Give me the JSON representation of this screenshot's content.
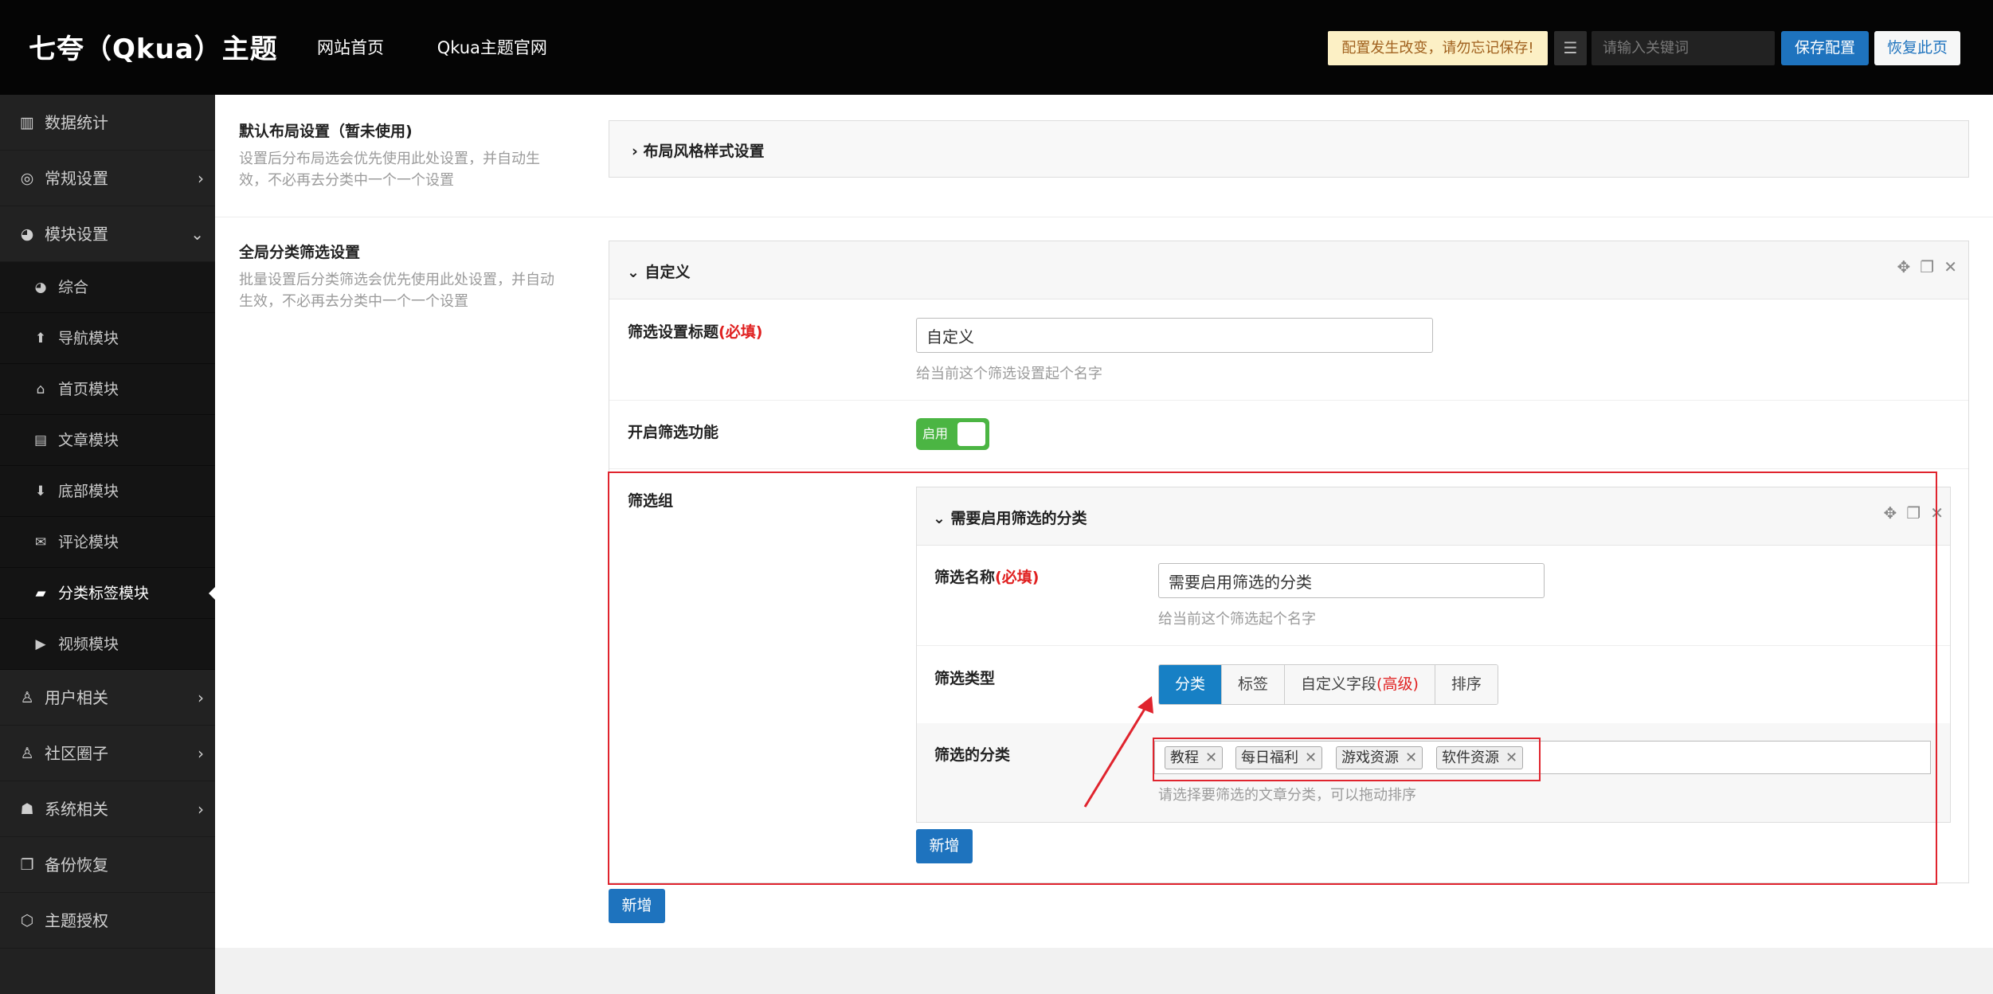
{
  "header": {
    "brand": "七夸（Qkua）主题",
    "nav": [
      "网站首页",
      "Qkua主题官网"
    ],
    "notice": "配置发生改变，请勿忘记保存!",
    "search_placeholder": "请输入关键词",
    "save_label": "保存配置",
    "restore_label": "恢复此页"
  },
  "sidebar": {
    "items": [
      {
        "label": "数据统计",
        "icon": "chart-icon"
      },
      {
        "label": "常规设置",
        "icon": "target-icon"
      },
      {
        "label": "模块设置",
        "icon": "pie-icon"
      },
      {
        "label": "用户相关",
        "icon": "user-icon"
      },
      {
        "label": "社区圈子",
        "icon": "user-icon"
      },
      {
        "label": "系统相关",
        "icon": "robot-icon"
      },
      {
        "label": "备份恢复",
        "icon": "copy-icon"
      },
      {
        "label": "主题授权",
        "icon": "gitlab-icon"
      }
    ],
    "sub_items": [
      "综合",
      "导航模块",
      "首页模块",
      "文章模块",
      "底部模块",
      "评论模块",
      "分类标签模块",
      "视频模块"
    ]
  },
  "main": {
    "layout_title": "默认布局设置（暂未使用)",
    "layout_desc1": "设置后分布局选会优先使用此处设置，并自动生",
    "layout_desc2": "效，不必再去分类中一个一个设置",
    "layout_accordion": "布局风格样式设置",
    "filter_title": "全局分类筛选设置",
    "filter_desc1": "批量设置后分类筛选会优先使用此处设置，并自动",
    "filter_desc2": "生效，不必再去分类中一个一个设置",
    "panel_title": "自定义",
    "title_label": "筛选设置标题",
    "required": "(必填)",
    "title_value": "自定义",
    "title_help": "给当前这个筛选设置起个名字",
    "enable_label": "开启筛选功能",
    "enable_text": "启用",
    "group_label": "筛选组",
    "sub_panel_title": "需要启用筛选的分类",
    "name_label": "筛选名称",
    "name_value": "需要启用筛选的分类",
    "name_help": "给当前这个筛选起个名字",
    "type_label": "筛选类型",
    "types": [
      "分类",
      "标签",
      "自定义字段",
      "排序"
    ],
    "type_advanced": "(高级)",
    "cat_label": "筛选的分类",
    "tags": [
      "教程",
      "每日福利",
      "游戏资源",
      "软件资源"
    ],
    "cat_help": "请选择要筛选的文章分类，可以拖动排序",
    "add_inner": "新增",
    "add_outer": "新增"
  },
  "colors": {
    "accent": "#1e73be",
    "highlight": "#e0242e",
    "toggle_on": "#4bb543"
  }
}
